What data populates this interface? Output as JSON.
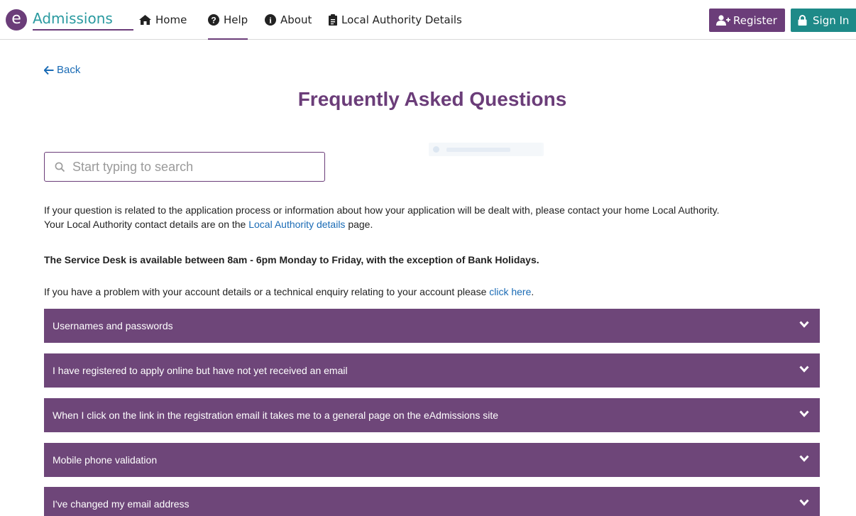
{
  "brand": {
    "mark": "e",
    "name": "Admissions"
  },
  "nav": {
    "home": "Home",
    "help": "Help",
    "about": "About",
    "local_authority": "Local Authority Details"
  },
  "buttons": {
    "register": "Register",
    "sign_in": "Sign In"
  },
  "back_label": "Back",
  "page_title": "Frequently Asked Questions",
  "search": {
    "placeholder": "Start typing to search"
  },
  "intro": {
    "line1": "If your question is related to the application process or information about how your application will be dealt with, please contact your home Local Authority.",
    "line2_before": "Your Local Authority contact details are on the ",
    "line2_link": "Local Authority details",
    "line2_after": " page."
  },
  "service_desk_notice": "The Service Desk is available between 8am - 6pm Monday to Friday, with the exception of Bank Holidays.",
  "account_help": {
    "before": "If you have a problem with your account details or a technical enquiry relating to your account please ",
    "link": "click here",
    "after": "."
  },
  "faqs": [
    {
      "question": "Usernames and passwords"
    },
    {
      "question": "I have registered to apply online but have not yet received an email"
    },
    {
      "question": "When I click on the link in the registration email it takes me to a general page on the eAdmissions site"
    },
    {
      "question": "Mobile phone validation"
    },
    {
      "question": "I've changed my email address"
    }
  ],
  "colors": {
    "brand_purple": "#6b3d79",
    "faq_purple": "#6e4679",
    "teal": "#1e8a88",
    "link_blue": "#1a6bb5"
  },
  "icons": {
    "home": "home-icon",
    "help": "question-circle-icon",
    "about": "info-circle-icon",
    "local_authority": "clipboard-icon",
    "register": "user-plus-icon",
    "sign_in": "lock-icon",
    "back": "arrow-left-icon",
    "search": "search-icon",
    "faq_toggle": "chevron-down-icon"
  }
}
